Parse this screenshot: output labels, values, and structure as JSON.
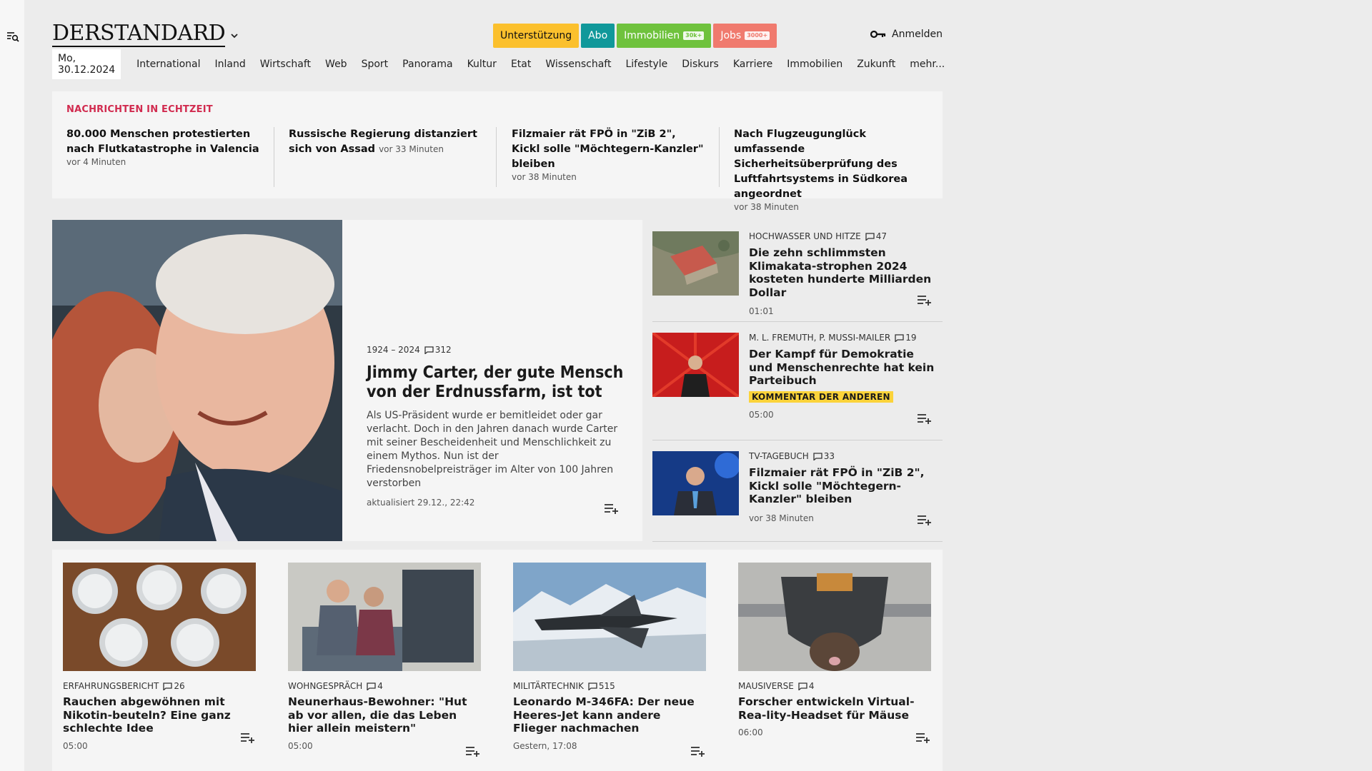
{
  "header": {
    "logo": "DERSTANDARD",
    "pills": [
      {
        "label": "Unterstützung",
        "badge": ""
      },
      {
        "label": "Abo",
        "badge": ""
      },
      {
        "label": "Immobilien",
        "badge": "30k+"
      },
      {
        "label": "Jobs",
        "badge": "3000+"
      }
    ],
    "login": "Anmelden",
    "date": "Mo, 30.12.2024",
    "nav": [
      "International",
      "Inland",
      "Wirtschaft",
      "Web",
      "Sport",
      "Panorama",
      "Kultur",
      "Etat",
      "Wissenschaft",
      "Lifestyle",
      "Diskurs",
      "Karriere",
      "Immobilien",
      "Zukunft",
      "mehr..."
    ]
  },
  "realtime": {
    "title": "NACHRICHTEN IN ECHTZEIT",
    "items": [
      {
        "title": "80.000 Menschen protestierten nach Flutkatastrophe in Valencia",
        "time": "vor 4 Minuten"
      },
      {
        "title": "Russische Regierung distanziert sich von Assad",
        "time": "vor 33 Minuten"
      },
      {
        "title": "Filzmaier rät FPÖ in \"ZiB 2\", Kickl solle \"Möchtegern-Kanzler\" bleiben",
        "time": "vor 38 Minuten"
      },
      {
        "title": "Nach Flugzeugunglück umfassende Sicherheitsüberprüfung des Luftfahrtsystems in Südkorea angeordnet",
        "time": "vor 38 Minuten"
      }
    ]
  },
  "lead": {
    "kicker": "1924 – 2024",
    "comments": "312",
    "title": "Jimmy Carter, der gute Mensch von der Erdnussfarm, ist tot",
    "teaser": "Als US-Präsident wurde er bemitleidet oder gar verlacht. Doch in den Jahren danach wurde Carter mit seiner Bescheidenheit und Menschlichkeit zu einem Mythos. Nun ist der Friedensnobelpreisträger im Alter von 100 Jahren verstorben",
    "time": "aktualisiert 29.12., 22:42"
  },
  "side": [
    {
      "kicker": "HOCHWASSER UND HITZE",
      "comments": "47",
      "title": "Die zehn schlimmsten Klimakata-strophen 2024 kosteten hunderte Milliarden Dollar",
      "label": "",
      "time": "01:01"
    },
    {
      "kicker": "M. L. FREMUTH, P. MUSSI-MAILER",
      "comments": "19",
      "title": "Der Kampf für Demokratie und Menschenrechte hat kein Parteibuch",
      "label": "KOMMENTAR DER ANDEREN",
      "time": "05:00"
    },
    {
      "kicker": "TV-TAGEBUCH",
      "comments": "33",
      "title": "Filzmaier rät FPÖ in \"ZiB 2\", Kickl solle \"Möchtegern-Kanzler\" bleiben",
      "label": "",
      "time": "vor 38 Minuten"
    }
  ],
  "cards": [
    {
      "kicker": "ERFAHRUNGSBERICHT",
      "comments": "26",
      "title": "Rauchen abgewöhnen mit Nikotin-beuteln? Eine ganz schlechte Idee",
      "time": "05:00"
    },
    {
      "kicker": "WOHNGESPRÄCH",
      "comments": "4",
      "title": "Neunerhaus-Bewohner: \"Hut ab vor allen, die das Leben hier allein meistern\"",
      "time": "05:00"
    },
    {
      "kicker": "MILITÄRTECHNIK",
      "comments": "515",
      "title": "Leonardo M-346FA: Der neue Heeres-Jet kann andere Flieger nachmachen",
      "time": "Gestern, 17:08"
    },
    {
      "kicker": "MAUSIVERSE",
      "comments": "4",
      "title": "Forscher entwickeln Virtual-Rea-lity-Headset für Mäuse",
      "time": "06:00"
    }
  ],
  "colors": {
    "unterstuetzung": "#fbc02d",
    "abo": "#10989a",
    "immobilien": "#6fc23d",
    "jobs": "#f07a6e",
    "realtime_title": "#d12b4f",
    "kommentar_label": "#fbd33a"
  }
}
